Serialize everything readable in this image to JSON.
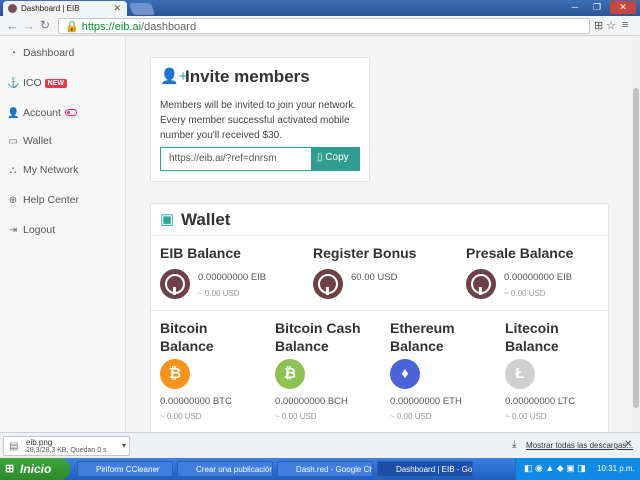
{
  "browser": {
    "tab_title": "Dashboard | EIB",
    "url_host": "https://eib.ai",
    "url_path": "/dashboard"
  },
  "sidebar": {
    "items": [
      {
        "label": "Dashboard",
        "icon": "dashboard-icon"
      },
      {
        "label": "ICO",
        "icon": "ico-icon",
        "badge": "NEW"
      },
      {
        "label": "Account",
        "icon": "account-icon"
      },
      {
        "label": "Wallet",
        "icon": "wallet-icon"
      },
      {
        "label": "My Network",
        "icon": "network-icon"
      },
      {
        "label": "Help Center",
        "icon": "help-icon"
      },
      {
        "label": "Logout",
        "icon": "logout-icon"
      }
    ]
  },
  "invite": {
    "title": "Invite members",
    "description": "Members will be invited to join your network. Every member successful activated mobile number you'll received $30.",
    "ref_link": "https://eib.ai/?ref=dnrsm",
    "copy_label": "Copy"
  },
  "wallet": {
    "title": "Wallet",
    "balances": [
      {
        "label": "EIB Balance",
        "amount": "0.00000000 EIB",
        "usd": "~ 0.00 USD",
        "icon": "eib-coin-icon"
      },
      {
        "label": "Register Bonus",
        "amount": "60.00 USD",
        "usd": "",
        "icon": "eib-coin-icon"
      },
      {
        "label": "Presale Balance",
        "amount": "0.00000000 EIB",
        "usd": "~ 0.00 USD",
        "icon": "eib-coin-icon"
      },
      {
        "label": "Bitcoin Balance",
        "amount": "0.00000000 BTC",
        "usd": "~ 0.00 USD",
        "icon": "bitcoin-icon",
        "color": "#f7931a"
      },
      {
        "label": "Bitcoin Cash Balance",
        "amount": "0.00000000 BCH",
        "usd": "~ 0.00 USD",
        "icon": "bitcoin-cash-icon",
        "color": "#8dc351"
      },
      {
        "label": "Ethereum Balance",
        "amount": "0.00000000 ETH",
        "usd": "~ 0.00 USD",
        "icon": "ethereum-icon",
        "color": "#4b63d8"
      },
      {
        "label": "Litecoin Balance",
        "amount": "0.00000000 LTC",
        "usd": "~ 0.00 USD",
        "icon": "litecoin-icon",
        "color": "#cfcfcf"
      }
    ]
  },
  "download": {
    "filename": "eib.png",
    "info": "28,3/28,3 KB, Quedan 0 s",
    "show_all": "Mostrar todas las descargas..."
  },
  "taskbar": {
    "start": "Inicio",
    "tasks": [
      "Piriform CCleaner",
      "Crear una publicación...",
      "Dash.red - Google Ch...",
      "Dashboard | EIB - Go..."
    ],
    "clock": "10:31 p.m."
  },
  "colors": {
    "accent": "#2fa597",
    "eib_coin": "#6e4048",
    "badge": "#e93a4c"
  }
}
